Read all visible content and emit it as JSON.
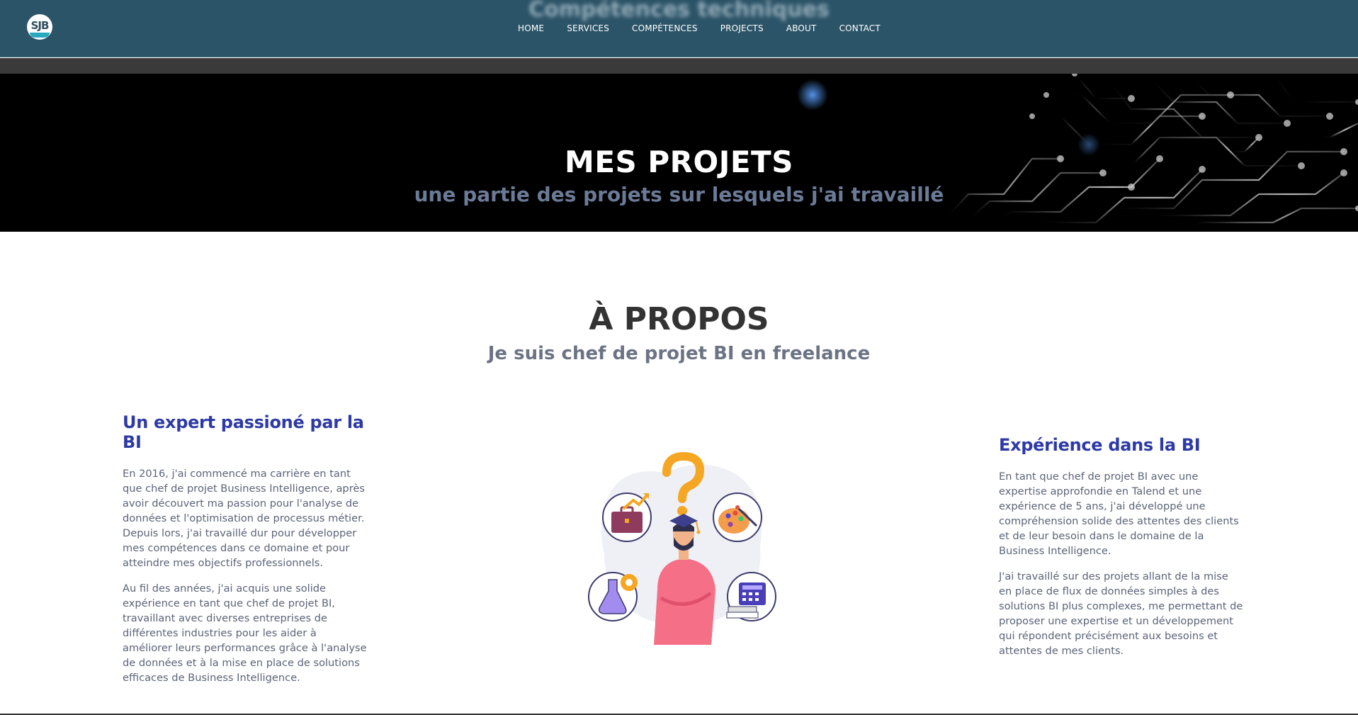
{
  "header": {
    "logo_text": "SJB",
    "ghost_title": "Compétences techniques",
    "nav": [
      "HOME",
      "SERVICES",
      "COMPÉTENCES",
      "PROJECTS",
      "ABOUT",
      "CONTACT"
    ]
  },
  "hero": {
    "title": "MES PROJETS",
    "subtitle": "une partie des projets sur lesquels j'ai travaillé"
  },
  "about": {
    "title": "À PROPOS",
    "subtitle": "Je suis chef de projet BI en freelance",
    "left": {
      "heading": "Un expert passioné par la BI",
      "paragraphs": [
        "En 2016, j'ai commencé ma carrière en tant que chef de projet Business Intelligence, après avoir découvert ma passion pour l'analyse de données et l'optimisation de processus métier. Depuis lors, j'ai travaillé dur pour développer mes compétences dans ce domaine et pour atteindre mes objectifs professionnels.",
        "Au fil des années, j'ai acquis une solide expérience en tant que chef de projet BI, travaillant avec diverses entreprises de différentes industries pour les aider à améliorer leurs performances grâce à l'analyse de données et à la mise en place de solutions efficaces de Business Intelligence."
      ]
    },
    "right": {
      "heading": "Expérience dans la BI",
      "paragraphs": [
        "En tant que chef de projet BI avec une expertise approfondie en Talend et une expérience de 5 ans, j'ai développé une compréhension solide des attentes des clients et de leur besoin dans le domaine de la Business Intelligence.",
        "J'ai travaillé sur des projets allant de la mise en place de flux de données simples à des solutions BI plus complexes, me permettant de proposer une expertise et un développement qui répondent précisément aux besoins et attentes de mes clients."
      ]
    }
  },
  "colors": {
    "header_bg": "#2c5468",
    "hero_bg": "#000000",
    "heading_blue": "#2d3aa6",
    "body_text": "#5b6478"
  },
  "icons": [
    "question-mark-icon",
    "briefcase-icon",
    "palette-icon",
    "flask-icon",
    "calculator-icon",
    "graduation-cap-icon"
  ]
}
